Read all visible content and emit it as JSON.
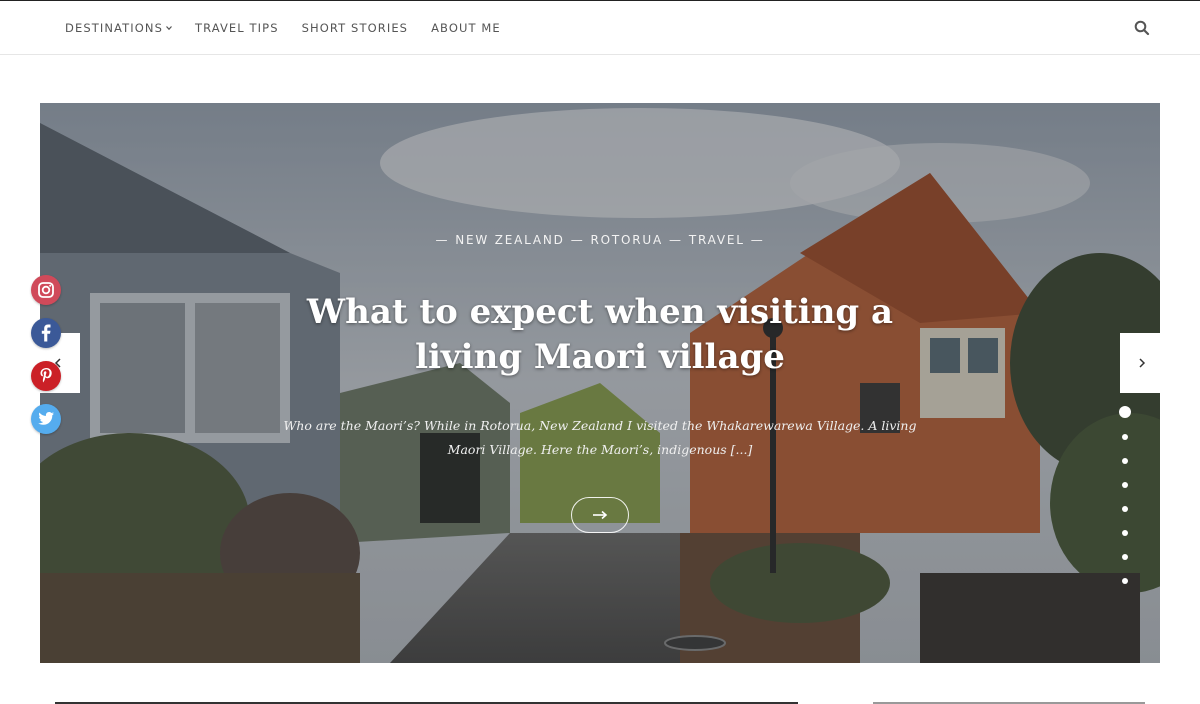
{
  "nav": {
    "items": [
      {
        "label": "DESTINATIONS",
        "has_dropdown": true
      },
      {
        "label": "TRAVEL TIPS"
      },
      {
        "label": "SHORT STORIES"
      },
      {
        "label": "ABOUT ME"
      }
    ],
    "search_icon": "search-icon"
  },
  "hero": {
    "categories": [
      "NEW ZEALAND",
      "ROTORUA",
      "TRAVEL"
    ],
    "title": "What to expect when visiting a living Maori village",
    "excerpt": "Who are the Maori’s? While in Rotorua, New Zealand I visited the Whakarewarewa Village. A living Maori Village. Here the Maori’s, indigenous [...]",
    "read_more_icon": "arrow-right-icon",
    "slide_count": 8,
    "active_slide": 1
  },
  "social": [
    "instagram-icon",
    "facebook-icon",
    "pinterest-icon",
    "twitter-icon"
  ],
  "colors": {
    "instagram": "#c13584",
    "facebook": "#3b5998",
    "pinterest": "#cb2027",
    "twitter": "#55acee"
  }
}
